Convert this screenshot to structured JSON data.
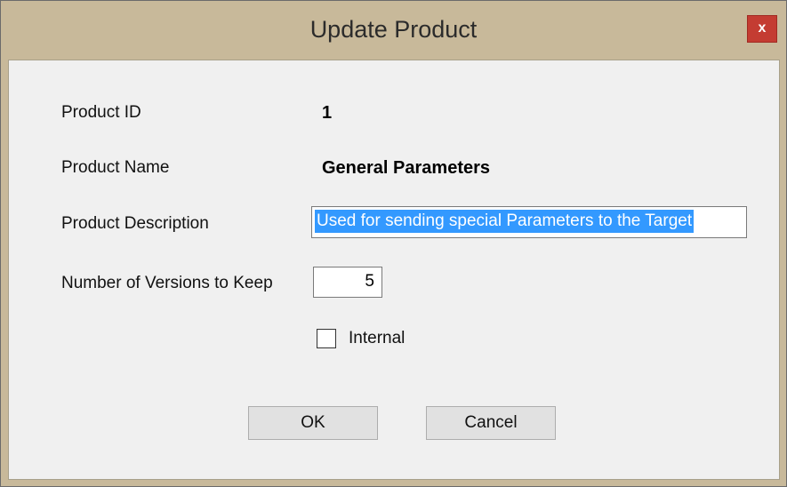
{
  "window": {
    "title": "Update Product",
    "close_label": "x"
  },
  "form": {
    "product_id_label": "Product ID",
    "product_id_value": "1",
    "product_name_label": "Product Name",
    "product_name_value": "General Parameters",
    "product_description_label": "Product Description",
    "product_description_value": "Used for sending special Parameters to the Target",
    "versions_label": "Number of Versions to Keep",
    "versions_value": "5",
    "internal_label": "Internal",
    "internal_checked": false
  },
  "buttons": {
    "ok_label": "OK",
    "cancel_label": "Cancel"
  }
}
